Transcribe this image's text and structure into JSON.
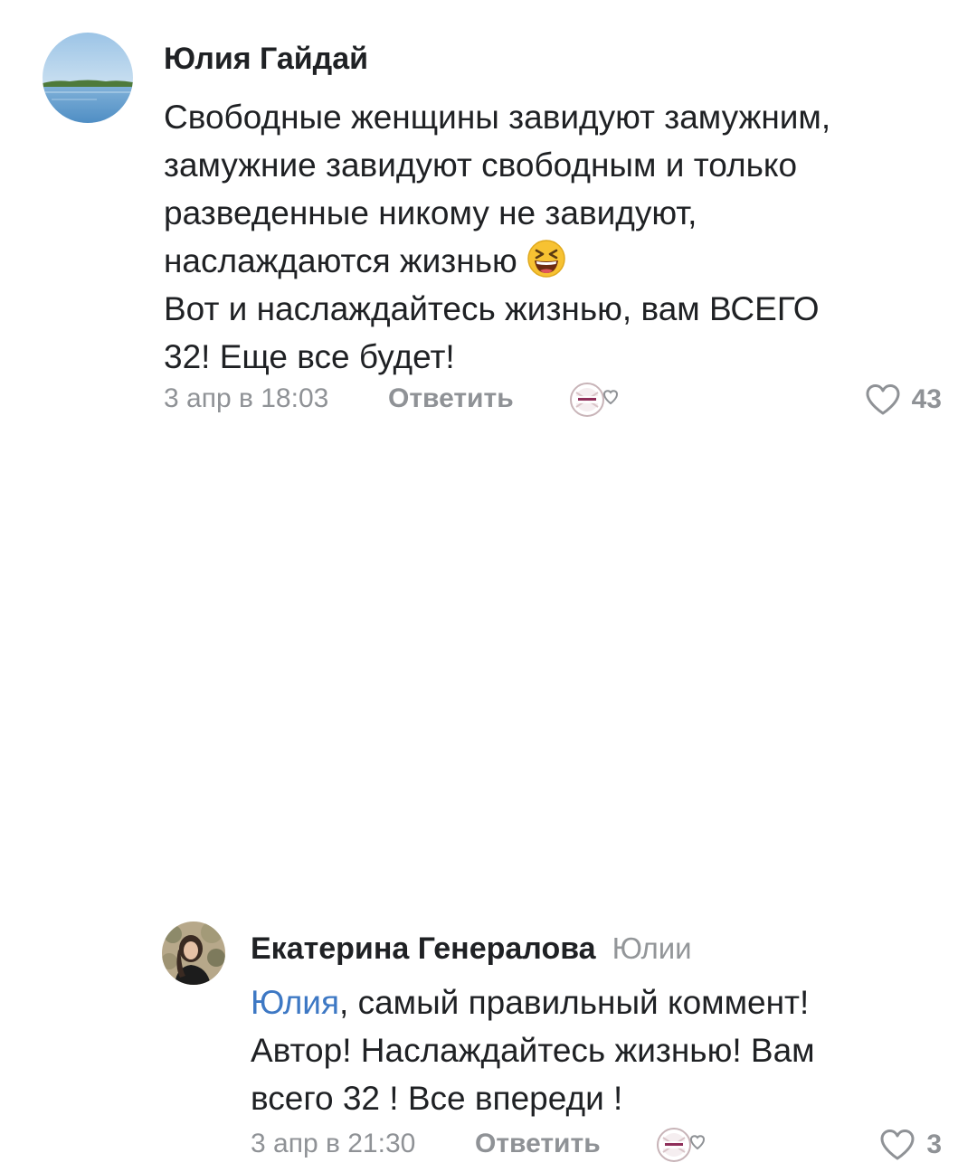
{
  "comments": [
    {
      "author": "Юлия Гайдай",
      "text_lines": [
        "Свободные женщины завидуют замужним,",
        "замужние завидуют свободным и только",
        "разведенные никому не завидуют,",
        "наслаждаются жизнью",
        "Вот и наслаждайтесь жизнью, вам ВСЕГО",
        "32! Еще все будет!"
      ],
      "emoji_icon": "laughing-squint-emoji",
      "time": "3 апр в 18:03",
      "reply_label": "Ответить",
      "likes": "43"
    },
    {
      "author": "Екатерина Генералова",
      "reply_to": "Юлии",
      "mention": "Юлия",
      "text_lines": [
        ", самый правильный коммент!",
        "Автор! Наслаждайтесь жизнью! Вам",
        "всего 32 ! Все впереди !"
      ],
      "time": "3 апр в 21:30",
      "reply_label": "Ответить",
      "likes": "3"
    }
  ],
  "icons": {
    "reaction": "author-like-badge-icon",
    "like": "heart-outline-icon"
  },
  "colors": {
    "text": "#1f2124",
    "secondary": "#8f9296",
    "mention": "#3d78c4",
    "emoji": "#f7c232"
  }
}
